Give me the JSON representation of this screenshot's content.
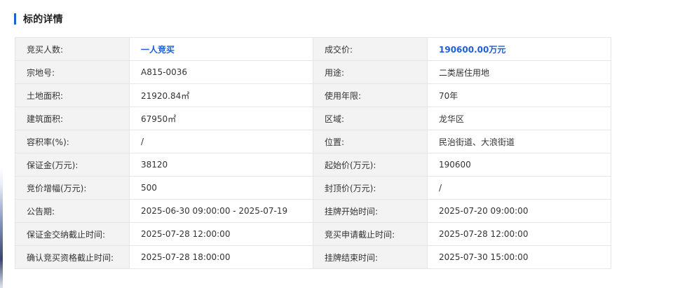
{
  "section": {
    "title": "标的详情"
  },
  "colors": {
    "accent": "#1f5fd6",
    "label_bg": "#f3f3f3",
    "border": "#e6e6e6"
  },
  "rows": [
    {
      "l1": "竞买人数:",
      "v1": "一人竞买",
      "l2": "成交价:",
      "v2": "190600.00万元"
    },
    {
      "l1": "宗地号:",
      "v1": "A815-0036",
      "l2": "用途:",
      "v2": "二类居住用地"
    },
    {
      "l1": "土地面积:",
      "v1": "21920.84㎡",
      "l2": "使用年限:",
      "v2": "70年"
    },
    {
      "l1": "建筑面积:",
      "v1": "67950㎡",
      "l2": "区域:",
      "v2": "龙华区"
    },
    {
      "l1": "容积率(%):",
      "v1": "/",
      "l2": "位置:",
      "v2": "民治街道、大浪街道"
    },
    {
      "l1": "保证金(万元):",
      "v1": "38120",
      "l2": "起始价(万元):",
      "v2": "190600"
    },
    {
      "l1": "竞价增幅(万元):",
      "v1": "500",
      "l2": "封顶价(万元):",
      "v2": "/"
    },
    {
      "l1": "公告期:",
      "v1": "2025-06-30 09:00:00 - 2025-07-19",
      "l2": "挂牌开始时间:",
      "v2": "2025-07-20 09:00:00"
    },
    {
      "l1": "保证金交纳截止时间:",
      "v1": "2025-07-28 12:00:00",
      "l2": "竞买申请截止时间:",
      "v2": "2025-07-28 12:00:00"
    },
    {
      "l1": "确认竞买资格截止时间:",
      "v1": "2025-07-28 18:00:00",
      "l2": "挂牌结束时间:",
      "v2": "2025-07-30 15:00:00"
    }
  ]
}
